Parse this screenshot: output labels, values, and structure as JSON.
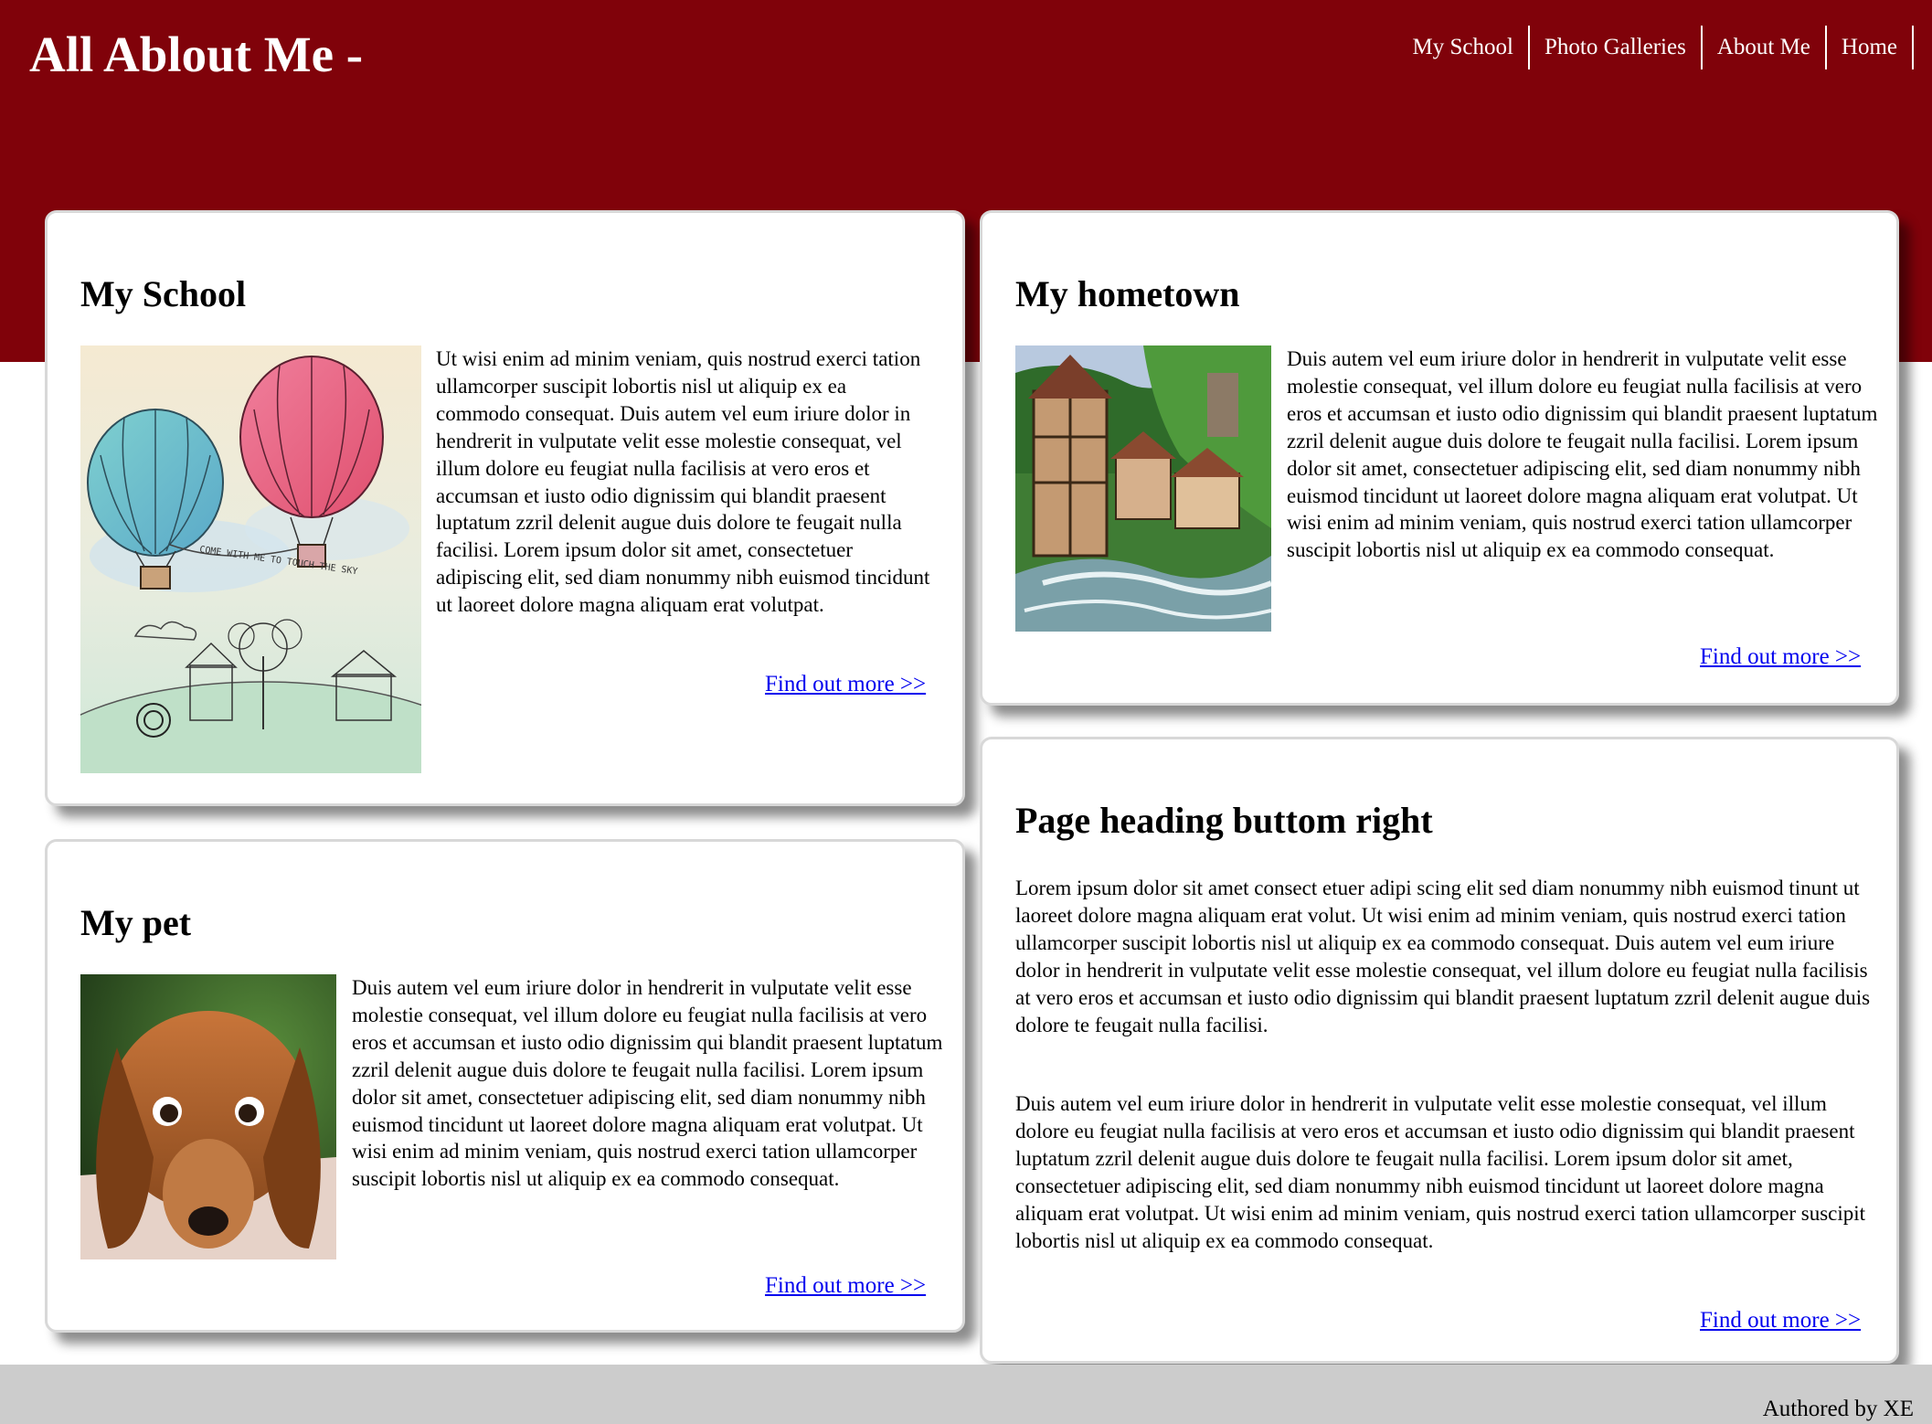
{
  "header": {
    "title": "All Ablout Me -",
    "nav": [
      {
        "label": "My School"
      },
      {
        "label": "Photo Galleries"
      },
      {
        "label": "About Me"
      },
      {
        "label": "Home"
      }
    ]
  },
  "cards": {
    "school": {
      "heading": "My School",
      "image": "hot-air-balloons-illustration",
      "image_caption": "COME WITH ME TO TOUCH THE SKY",
      "body": "Ut wisi enim ad minim veniam, quis nostrud exerci tation ullamcorper suscipit lobortis nisl ut aliquip ex ea commodo consequat. Duis autem vel eum iriure dolor in hendrerit in vulputate velit esse molestie consequat, vel illum dolore eu feugiat nulla facilisis at vero eros et accumsan et iusto odio dignissim qui blandit praesent luptatum zzril delenit augue duis dolore te feugait nulla facilisi. Lorem ipsum dolor sit amet, consectetuer adipiscing elit, sed diam nonummy nibh euismod tincidunt ut laoreet dolore magna aliquam erat volutpat.",
      "link": "Find out more >>"
    },
    "hometown": {
      "heading": "My hometown",
      "image": "village-river-photo",
      "body": "Duis autem vel eum iriure dolor in hendrerit in vulputate velit esse molestie consequat, vel illum dolore eu feugiat nulla facilisis at vero eros et accumsan et iusto odio dignissim qui blandit praesent luptatum zzril delenit augue duis dolore te feugait nulla facilisi. Lorem ipsum dolor sit amet, consectetuer adipiscing elit, sed diam nonummy nibh euismod tincidunt ut laoreet dolore magna aliquam erat volutpat. Ut wisi enim ad minim veniam, quis nostrud exerci tation ullamcorper suscipit lobortis nisl ut aliquip ex ea commodo consequat.",
      "link": "Find out more >>"
    },
    "pet": {
      "heading": "My pet",
      "image": "dachshund-photo",
      "body": "Duis autem vel eum iriure dolor in hendrerit in vulputate velit esse molestie consequat, vel illum dolore eu feugiat nulla facilisis at vero eros et accumsan et iusto odio dignissim qui blandit praesent luptatum zzril delenit augue duis dolore te feugait nulla facilisi. Lorem ipsum dolor sit amet, consectetuer adipiscing elit, sed diam nonummy nibh euismod tincidunt ut laoreet dolore magna aliquam erat volutpat. Ut wisi enim ad minim veniam, quis nostrud exerci tation ullamcorper suscipit lobortis nisl ut aliquip ex ea commodo consequat.",
      "link": "Find out more >>"
    },
    "bottom_right": {
      "heading": "Page heading buttom right",
      "body1": "Lorem ipsum dolor sit amet consect etuer adipi scing elit sed diam nonummy nibh euismod tinunt ut laoreet dolore magna aliquam erat volut. Ut wisi enim ad minim veniam, quis nostrud exerci tation ullamcorper suscipit lobortis nisl ut aliquip ex ea commodo consequat. Duis autem vel eum iriure dolor in hendrerit in vulputate velit esse molestie consequat, vel illum dolore eu feugiat nulla facilisis at vero eros et accumsan et iusto odio dignissim qui blandit praesent luptatum zzril delenit augue duis dolore te feugait nulla facilisi.",
      "body2": "Duis autem vel eum iriure dolor in hendrerit in vulputate velit esse molestie consequat, vel illum dolore eu feugiat nulla facilisis at vero eros et accumsan et iusto odio dignissim qui blandit praesent luptatum zzril delenit augue duis dolore te feugait nulla facilisi. Lorem ipsum dolor sit amet, consectetuer adipiscing elit, sed diam nonummy nibh euismod tincidunt ut laoreet dolore magna aliquam erat volutpat. Ut wisi enim ad minim veniam, quis nostrud exerci tation ullamcorper suscipit lobortis nisl ut aliquip ex ea commodo consequat.",
      "link": "Find out more >>"
    }
  },
  "footer": {
    "text": "Authored by XE"
  },
  "colors": {
    "header_bg": "#80020a",
    "footer_bg": "#cccccc",
    "link": "#0000ee"
  }
}
